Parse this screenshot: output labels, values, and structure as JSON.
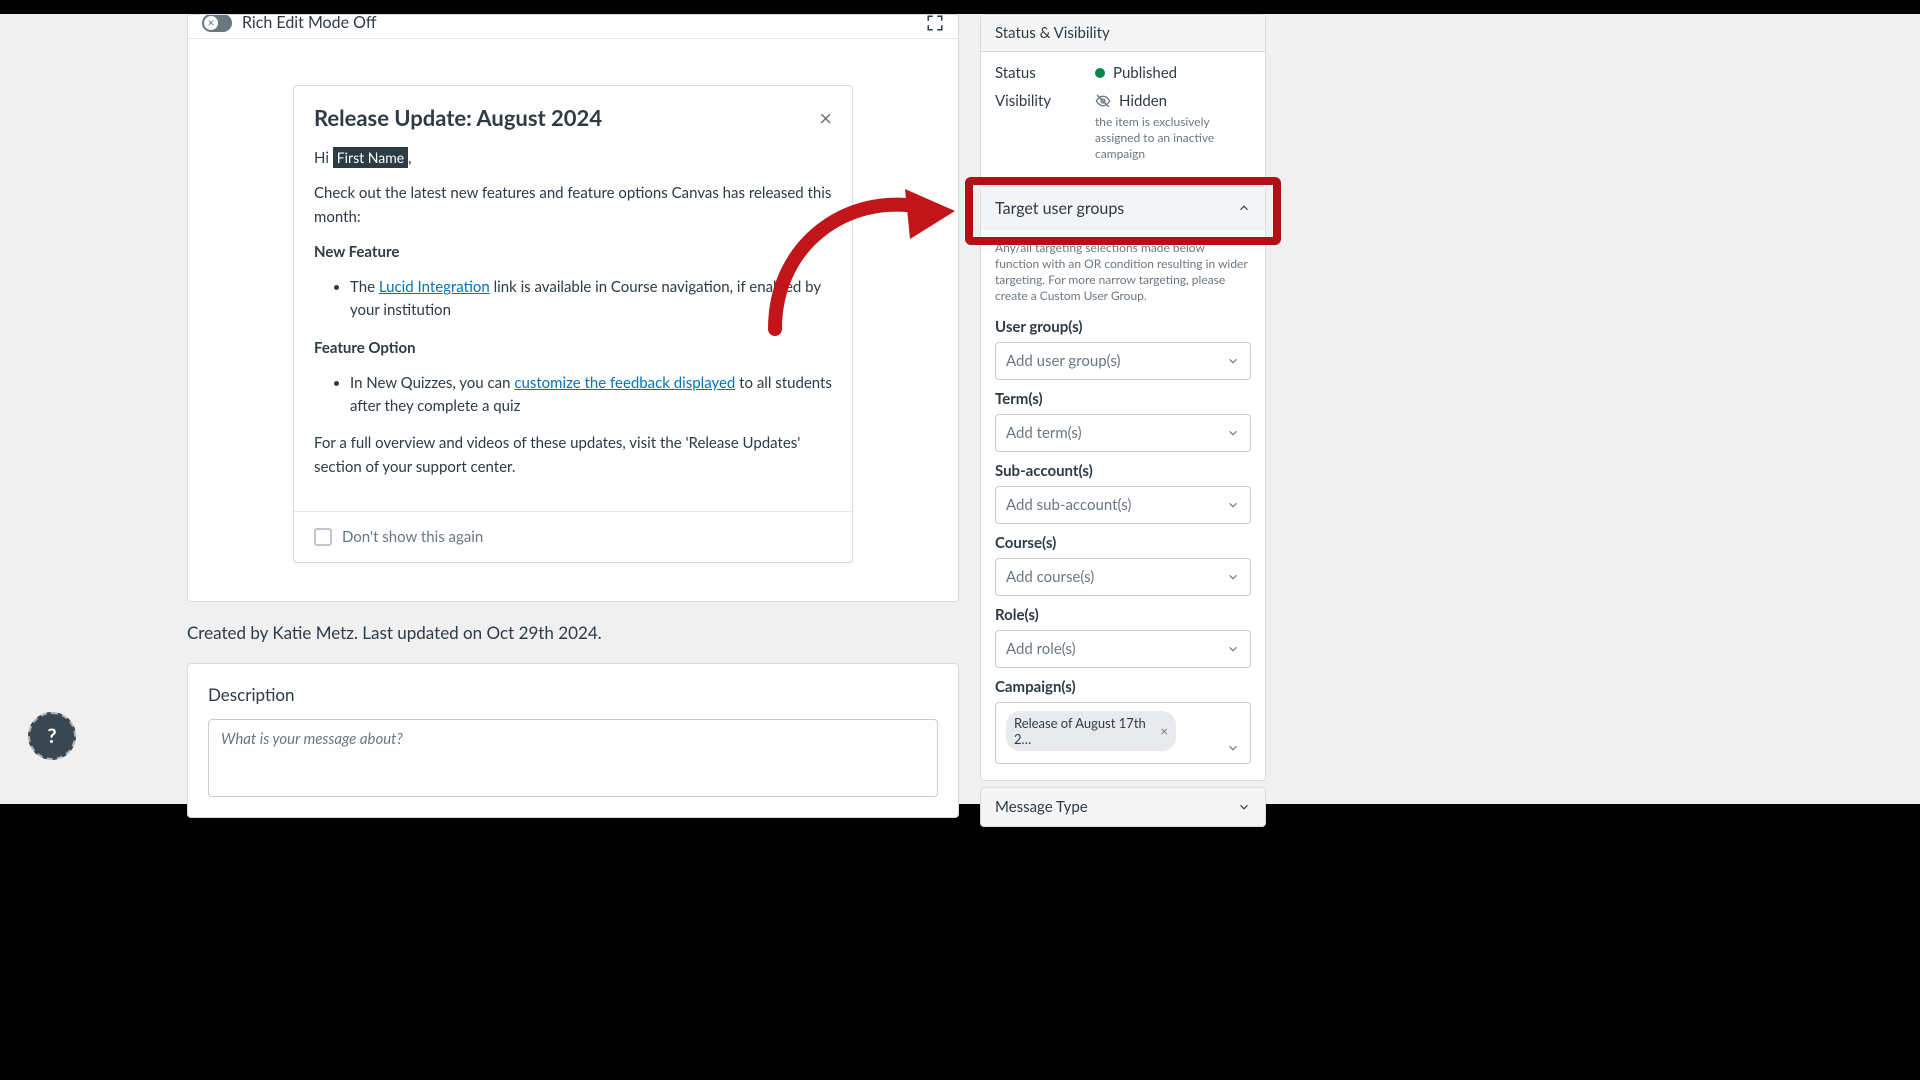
{
  "toolbar": {
    "rich_edit_label": "Rich Edit Mode Off"
  },
  "dialog": {
    "title": "Release Update: August 2024",
    "greeting_prefix": "Hi",
    "greeting_token": "First Name",
    "greeting_suffix": ",",
    "intro": "Check out the latest new features and feature options Canvas has released this month:",
    "new_feature_label": "New Feature",
    "nf_list_prefix": "The",
    "nf_link": "Lucid Integration",
    "nf_list_suffix": "link is available in Course navigation, if enabled by your institution",
    "feature_option_label": "Feature Option",
    "fo_list_prefix": "In New Quizzes, you can",
    "fo_link": "customize the feedback displayed",
    "fo_list_suffix": "to all students after they complete a quiz",
    "closing": "For a full overview and videos of these updates, visit the 'Release Updates' section of your support center.",
    "dont_show": "Don't show this again"
  },
  "created_line": "Created by Katie Metz. Last updated on Oct 29th 2024.",
  "description": {
    "label": "Description",
    "placeholder": "What is your message about?"
  },
  "rail": {
    "status_visibility_header": "Status & Visibility",
    "status_label": "Status",
    "status_value": "Published",
    "visibility_label": "Visibility",
    "visibility_value": "Hidden",
    "visibility_note": "the item is exclusively assigned to an inactive campaign",
    "targets_header": "Target user groups",
    "targets_note": "Any/all targeting selections made below function with an OR condition resulting in wider targeting. For more narrow targeting, please create a Custom User Group.",
    "user_groups_label": "User group(s)",
    "user_groups_placeholder": "Add user group(s)",
    "terms_label": "Term(s)",
    "terms_placeholder": "Add term(s)",
    "subaccounts_label": "Sub-account(s)",
    "subaccounts_placeholder": "Add sub-account(s)",
    "courses_label": "Course(s)",
    "courses_placeholder": "Add course(s)",
    "roles_label": "Role(s)",
    "roles_placeholder": "Add role(s)",
    "campaigns_label": "Campaign(s)",
    "campaign_chip": "Release of August 17th 2…",
    "message_type_header": "Message Type"
  },
  "help": "?"
}
